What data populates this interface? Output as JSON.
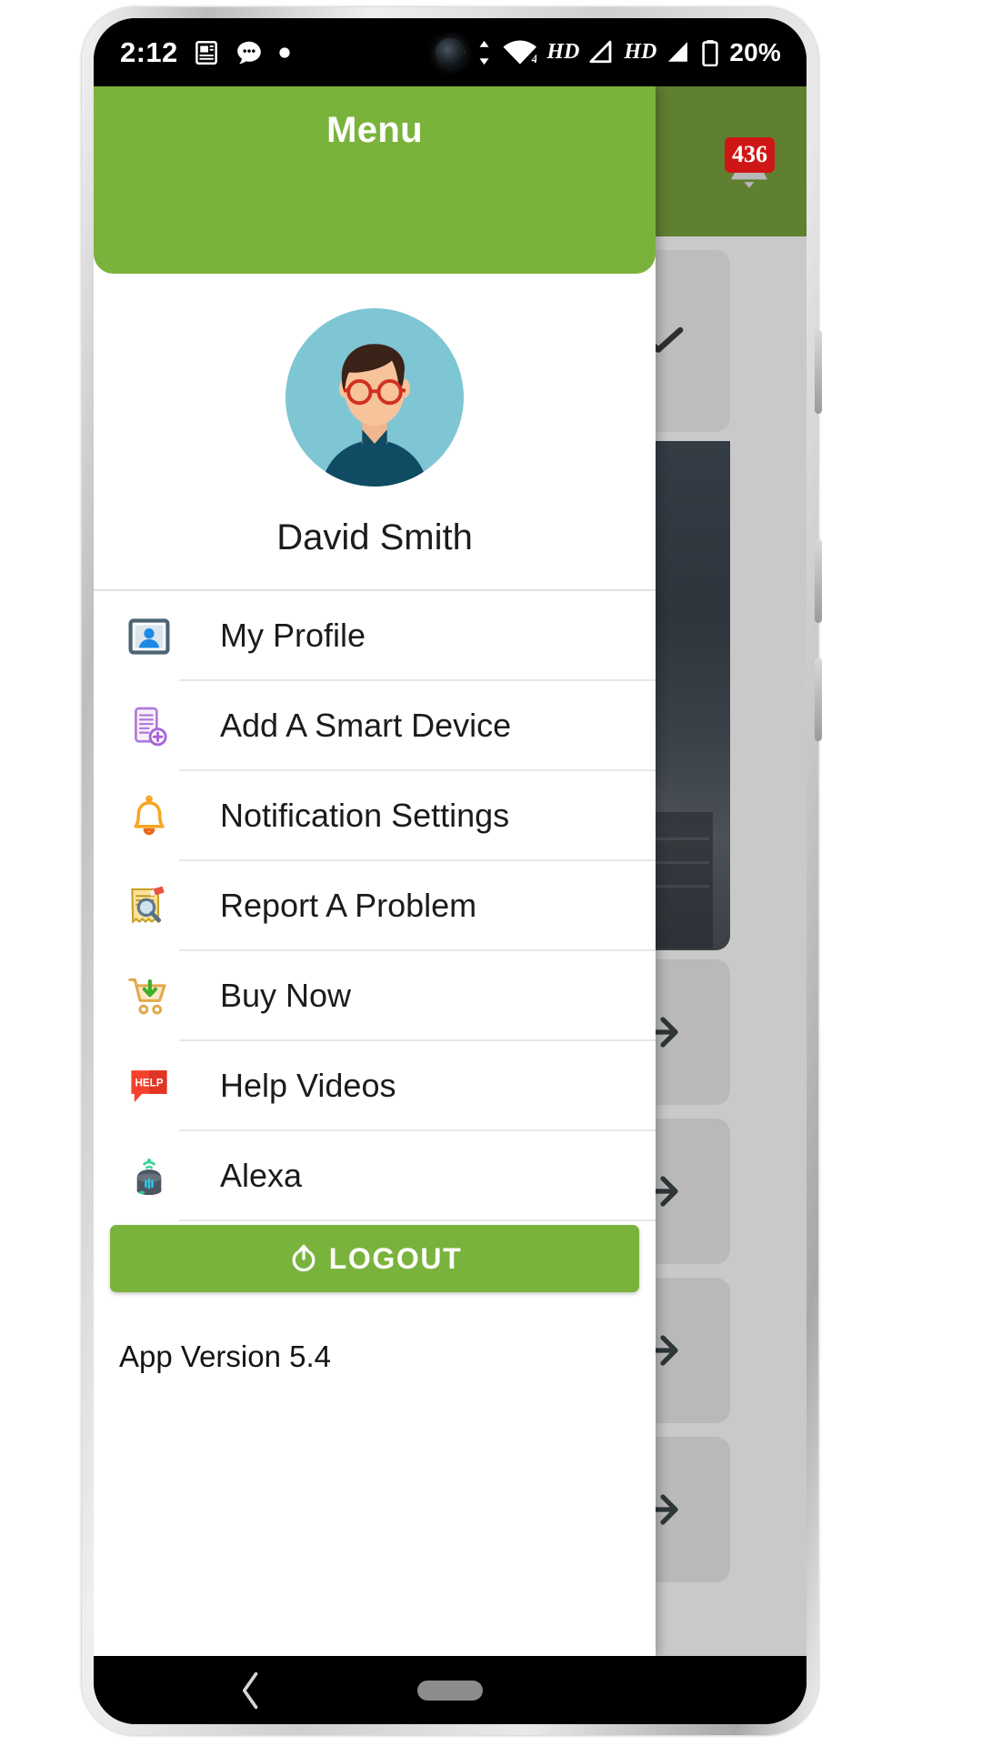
{
  "status_bar": {
    "clock": "2:12",
    "icons_left": [
      "news-icon",
      "message-icon",
      "dot-icon"
    ],
    "icons_right": [
      "dot-icon",
      "data-transfer-icon",
      "wifi-icon",
      "hd-icon",
      "signal-icon",
      "hd-icon-2",
      "signal-icon-2",
      "battery-icon"
    ],
    "hd_label": "HD",
    "hd_label_2": "HD",
    "wifi_band": "4",
    "battery_percent": "20%"
  },
  "background": {
    "notification_badge": "436",
    "bell_icon": "bell-icon",
    "expand_icon": "chevron-down-icon",
    "arrow_icon": "arrow-right-icon",
    "cards": [
      "bg-card-1",
      "bg-card-2",
      "bg-card-3",
      "bg-card-4"
    ]
  },
  "drawer": {
    "title": "Menu",
    "user_name": "David Smith",
    "avatar": "user-avatar",
    "menu_items": [
      {
        "label": "My Profile",
        "icon": "contact-card-icon"
      },
      {
        "label": "Add A Smart Device",
        "icon": "add-device-icon"
      },
      {
        "label": "Notification Settings",
        "icon": "bell-icon"
      },
      {
        "label": "Report A Problem",
        "icon": "report-problem-icon"
      },
      {
        "label": "Buy Now",
        "icon": "shopping-cart-icon"
      },
      {
        "label": "Help Videos",
        "icon": "help-badge-icon"
      },
      {
        "label": "Alexa",
        "icon": "smart-speaker-icon"
      }
    ],
    "logout_label": "LOGOUT",
    "logout_icon": "power-icon",
    "app_version": "App Version 5.4"
  },
  "nav_bar": {
    "back_icon": "chevron-left-icon",
    "home_icon": "home-pill-icon"
  },
  "colors": {
    "brand_green": "#7ab33c",
    "brand_green_dim": "#5f7f31",
    "badge_red": "#cf1616",
    "avatar_bg": "#7ec6d4",
    "background_grey": "#c9c9c9"
  }
}
